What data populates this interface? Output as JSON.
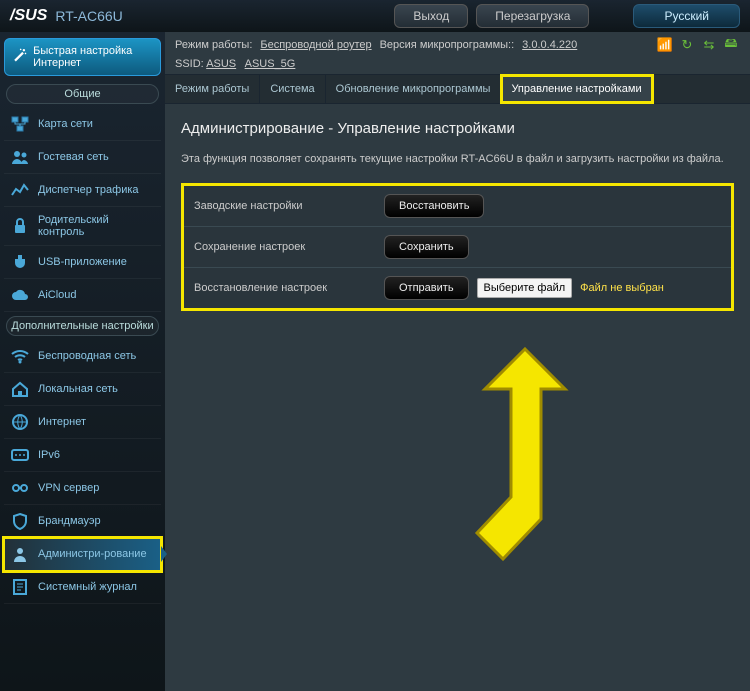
{
  "header": {
    "brand": "/SUS",
    "model": "RT-AC66U",
    "logout": "Выход",
    "reboot": "Перезагрузка",
    "language": "Русский"
  },
  "status": {
    "mode_label": "Режим работы:",
    "mode_value": "Беспроводной роутер",
    "fw_label": "Версия микропрограммы::",
    "fw_value": "3.0.0.4.220",
    "ssid_label": "SSID:",
    "ssid_24": "ASUS",
    "ssid_5": "ASUS_5G"
  },
  "qis": {
    "title": "Быстрая настройка Интернет"
  },
  "sections": {
    "general": "Общие",
    "advanced": "Дополнительные настройки"
  },
  "nav": {
    "general": [
      {
        "label": "Карта сети"
      },
      {
        "label": "Гостевая сеть"
      },
      {
        "label": "Диспетчер трафика"
      },
      {
        "label": "Родительский контроль"
      },
      {
        "label": "USB-приложение"
      },
      {
        "label": "AiCloud"
      }
    ],
    "advanced": [
      {
        "label": "Беспроводная сеть"
      },
      {
        "label": "Локальная сеть"
      },
      {
        "label": "Интернет"
      },
      {
        "label": "IPv6"
      },
      {
        "label": "VPN сервер"
      },
      {
        "label": "Брандмауэр"
      },
      {
        "label": "Администри-рование"
      },
      {
        "label": "Системный журнал"
      }
    ]
  },
  "tabs": [
    "Режим работы",
    "Система",
    "Обновление микропрограммы",
    "Управление настройками"
  ],
  "page": {
    "title": "Администрирование - Управление настройками",
    "desc": "Эта функция позволяет сохранять текущие настройки RT-AC66U в файл и загрузить настройки из файла."
  },
  "rows": {
    "factory": {
      "label": "Заводские настройки",
      "btn": "Восстановить"
    },
    "save": {
      "label": "Сохранение настроек",
      "btn": "Сохранить"
    },
    "restore": {
      "label": "Восстановление настроек",
      "btn": "Отправить",
      "file_btn": "Выберите файл",
      "file_status": "Файл не выбран"
    }
  }
}
